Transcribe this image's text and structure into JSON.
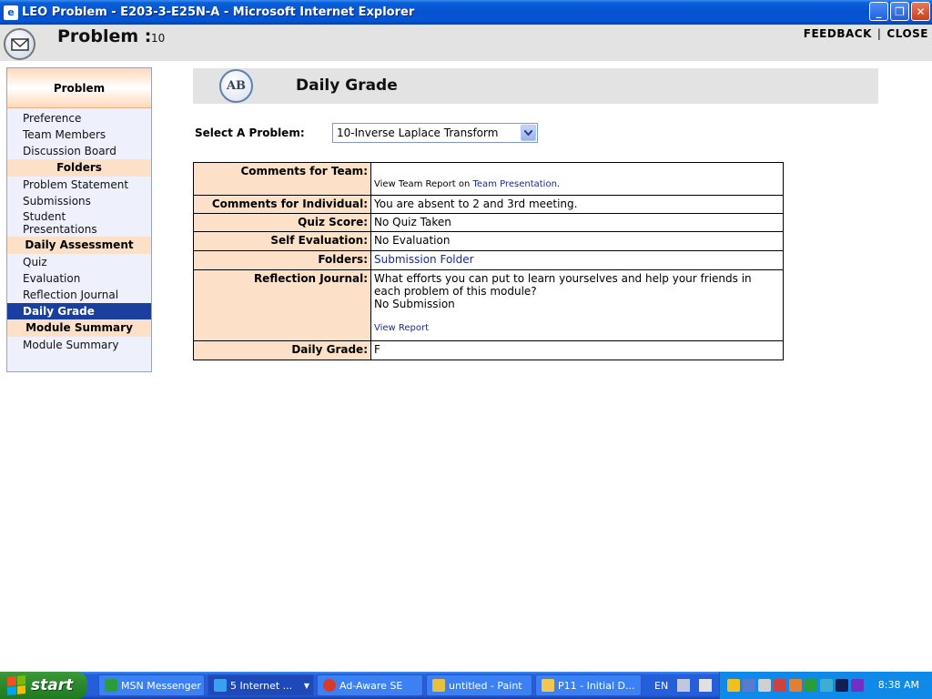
{
  "window": {
    "title": "LEO Problem - E203-3-E25N-A - Microsoft Internet Explorer",
    "controls": [
      "_",
      "❐",
      "✕"
    ]
  },
  "header": {
    "title": "Problem :",
    "number": "10",
    "feedback": "FEEDBACK",
    "separator": "|",
    "close": "CLOSE"
  },
  "sidebar": {
    "top_label": "Problem",
    "sections": [
      {
        "items": [
          "Preference",
          "Team Members",
          "Discussion Board"
        ]
      },
      {
        "header": "Folders",
        "items": [
          "Problem Statement",
          "Submissions",
          "Student Presentations"
        ]
      },
      {
        "header": "Daily Assessment",
        "items": [
          "Quiz",
          "Evaluation",
          "Reflection Journal",
          "Daily Grade"
        ]
      },
      {
        "header": "Module Summary",
        "items": [
          "Module Summary"
        ]
      }
    ],
    "active": "Daily Grade"
  },
  "main": {
    "heading": "Daily Grade",
    "badge": "AB",
    "select_label": "Select A Problem:",
    "select_value": "10-Inverse Laplace Transform",
    "rows": {
      "comments_team": {
        "label": "Comments for Team:",
        "prefix": "View Team Report on",
        "link": "Team Presentation",
        "suffix": "."
      },
      "comments_individual": {
        "label": "Comments for Individual:",
        "value": "You are absent to 2 and 3rd meeting."
      },
      "quiz": {
        "label": "Quiz Score:",
        "value": "No Quiz Taken"
      },
      "self_eval": {
        "label": "Self Evaluation:",
        "value": "No Evaluation"
      },
      "folders": {
        "label": "Folders:",
        "link": "Submission Folder"
      },
      "reflection": {
        "label": "Reflection Journal:",
        "question": "What efforts you can put to learn yourselves and help your friends in each problem of this module?",
        "status": "No Submission",
        "link": "View Report"
      },
      "grade": {
        "label": "Daily Grade:",
        "value": "F"
      }
    }
  },
  "taskbar": {
    "start": "start",
    "tasks": [
      {
        "label": "MSN Messenger",
        "color": "#2a9c3a"
      },
      {
        "label": "5 Internet ...",
        "color": "#3aa0f0"
      },
      {
        "label": "Ad-Aware SE",
        "color": "#d83a2a"
      },
      {
        "label": "untitled - Paint",
        "color": "#e8c040"
      },
      {
        "label": "P11 - Initial D...",
        "color": "#f0c850"
      }
    ],
    "lang": "EN",
    "clock": "8:38 AM"
  }
}
